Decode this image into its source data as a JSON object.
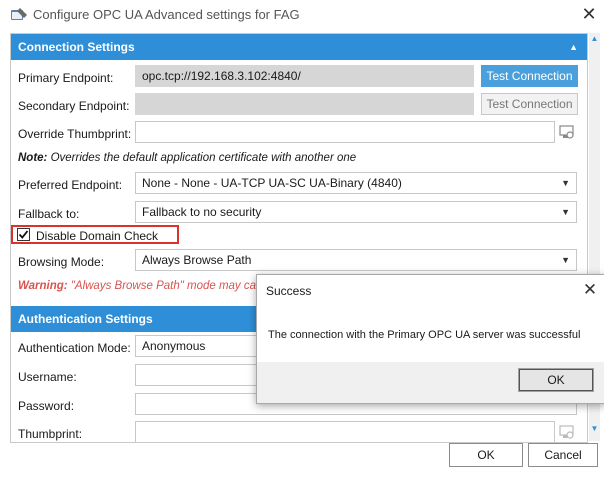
{
  "window": {
    "title": "Configure OPC UA Advanced settings for FAG",
    "close_glyph": "✕"
  },
  "connection": {
    "header": "Connection Settings",
    "primary_label": "Primary Endpoint:",
    "primary_value": "opc.tcp://192.168.3.102:4840/",
    "test_primary_label": "Test Connection",
    "secondary_label": "Secondary Endpoint:",
    "secondary_value": "",
    "test_secondary_label": "Test Connection",
    "override_label": "Override Thumbprint:",
    "override_value": "",
    "note_bold": "Note:",
    "note_text": " Overrides the default application certificate with another one",
    "preferred_label": "Preferred Endpoint:",
    "preferred_value": "None - None - UA-TCP UA-SC UA-Binary (4840)",
    "fallback_label": "Fallback to:",
    "fallback_value": "Fallback to no security",
    "disable_domain_label": "Disable Domain Check",
    "disable_domain_checked": true,
    "browsing_label": "Browsing Mode:",
    "browsing_value": "Always Browse Path",
    "warning_bold": "Warning:",
    "warning_text": " \"Always Browse Path\" mode may cau"
  },
  "authentication": {
    "header": "Authentication Settings",
    "mode_label": "Authentication Mode:",
    "mode_value": "Anonymous",
    "username_label": "Username:",
    "password_label": "Password:",
    "thumbprint_label": "Thumbprint:"
  },
  "dialog": {
    "title": "Success",
    "message": "The connection with the Primary OPC UA server was successful",
    "ok_label": "OK"
  },
  "footer": {
    "ok_label": "OK",
    "cancel_label": "Cancel"
  },
  "colors": {
    "section_header": "#2e8fd8",
    "highlight_box": "#d9332b",
    "warning_text": "#d9534f"
  }
}
